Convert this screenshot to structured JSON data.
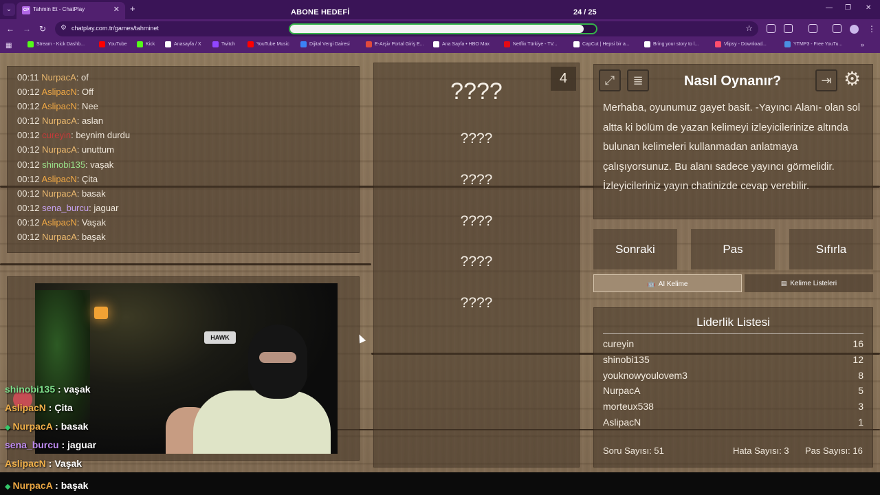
{
  "browser": {
    "tab_title": "Tahmin Et - ChatPlay",
    "tab_favicon": "CP",
    "url": "chatplay.com.tr/games/tahminet",
    "bookmarks": [
      {
        "label": "Stream - Kick Dashb...",
        "color": "#53fc18"
      },
      {
        "label": "YouTube",
        "color": "#ff0000"
      },
      {
        "label": "Kick",
        "color": "#53fc18"
      },
      {
        "label": "Anasayfa / X",
        "color": "#ffffff"
      },
      {
        "label": "Twitch",
        "color": "#9146ff"
      },
      {
        "label": "YouTube Music",
        "color": "#ff0000"
      },
      {
        "label": "Dijital Vergi Dairesi",
        "color": "#3b82f6"
      },
      {
        "label": "E-Arşiv Portal Giriş E...",
        "color": "#e04a3c"
      },
      {
        "label": "Ana Sayfa • HBO Max",
        "color": "#ffffff"
      },
      {
        "label": "Netflix Türkiye - TV...",
        "color": "#e50914"
      },
      {
        "label": "CapCut | Hepsi bir a...",
        "color": "#ffffff"
      },
      {
        "label": "Bring your story to l...",
        "color": "#ffffff"
      },
      {
        "label": "Vlipsy - Download...",
        "color": "#ff4d6d"
      },
      {
        "label": "YTMP3 - Free YouTu...",
        "color": "#4a90e2"
      }
    ]
  },
  "goal": {
    "title": "ABONE HEDEFİ",
    "count": "24 / 25",
    "progress": 0.96
  },
  "chat_log": [
    {
      "time": "00:11",
      "user": "NurpacA",
      "color": "#eab86e",
      "msg": ": of"
    },
    {
      "time": "00:12",
      "user": "AslipacN",
      "color": "#f0a844",
      "msg": ": Off"
    },
    {
      "time": "00:12",
      "user": "AslipacN",
      "color": "#f0a844",
      "msg": ": Nee"
    },
    {
      "time": "00:12",
      "user": "NurpacA",
      "color": "#eab86e",
      "msg": ": aslan"
    },
    {
      "time": "00:12",
      "user": "cureyin",
      "color": "#c83a3a",
      "msg": ": beynim durdu"
    },
    {
      "time": "00:12",
      "user": "NurpacA",
      "color": "#eab86e",
      "msg": ": unuttum"
    },
    {
      "time": "00:12",
      "user": "shinobi135",
      "color": "#9be38a",
      "msg": ": vaşak"
    },
    {
      "time": "00:12",
      "user": "AslipacN",
      "color": "#f0a844",
      "msg": ": Çita"
    },
    {
      "time": "00:12",
      "user": "NurpacA",
      "color": "#eab86e",
      "msg": ": basak"
    },
    {
      "time": "00:12",
      "user": "sena_burcu",
      "color": "#c6a2f0",
      "msg": ": jaguar"
    },
    {
      "time": "00:12",
      "user": "AslipacN",
      "color": "#f0a844",
      "msg": ": Vaşak"
    },
    {
      "time": "00:12",
      "user": "NurpacA",
      "color": "#eab86e",
      "msg": ": başak"
    }
  ],
  "video": {
    "chair_logo": "HAWK"
  },
  "overlay_chat": [
    {
      "user": "shinobi135",
      "color": "#7fe08c",
      "msg": " : vaşak",
      "badge": false
    },
    {
      "user": "AslipacN",
      "color": "#f0b04a",
      "msg": " : Çita",
      "badge": false
    },
    {
      "user": "NurpacA",
      "color": "#f0b04a",
      "msg": " : basak",
      "badge": true
    },
    {
      "user": "sena_burcu",
      "color": "#c08cf2",
      "msg": " : jaguar",
      "badge": false
    },
    {
      "user": "AslipacN",
      "color": "#f0b04a",
      "msg": " : Vaşak",
      "badge": false
    }
  ],
  "bottom_line": {
    "user": "NurpacA",
    "msg": " : başak",
    "badge_icon": "diamond-badge-icon"
  },
  "words": {
    "count": "4",
    "main": "????",
    "hidden": [
      "????",
      "????",
      "????",
      "????",
      "????"
    ]
  },
  "how_to_play": {
    "title": "Nasıl Oynanır?",
    "text": "Merhaba, oyunumuz gayet basit. -Yayıncı Alanı- olan sol altta ki bölüm de yazan kelimeyi izleyicilerinize altında bulunan kelimeleri kullanmadan anlatmaya çalışıyorsunuz. Bu alanı sadece yayıncı görmelidir. İzleyicileriniz yayın chatinizde cevap verebilir.",
    "icons": [
      "fullscreen-icon",
      "notes-icon",
      "exit-icon",
      "gear-icon"
    ]
  },
  "actions": {
    "next": "Sonraki",
    "pass": "Pas",
    "reset": "Sıfırla"
  },
  "tabs": {
    "ai_word": "AI Kelime",
    "word_lists": "Kelime Listeleri"
  },
  "leaderboard": {
    "title": "Liderlik Listesi",
    "rows": [
      {
        "name": "cureyin",
        "score": "16"
      },
      {
        "name": "shinobi135",
        "score": "12"
      },
      {
        "name": "youknowyoulovem3",
        "score": "8"
      },
      {
        "name": "NurpacA",
        "score": "5"
      },
      {
        "name": "morteux538",
        "score": "3"
      },
      {
        "name": "AslipacN",
        "score": "1"
      }
    ]
  },
  "stats": {
    "questions": "Soru Sayısı: 51",
    "errors": "Hata Sayısı: 3",
    "passes": "Pas Sayısı: 16"
  }
}
